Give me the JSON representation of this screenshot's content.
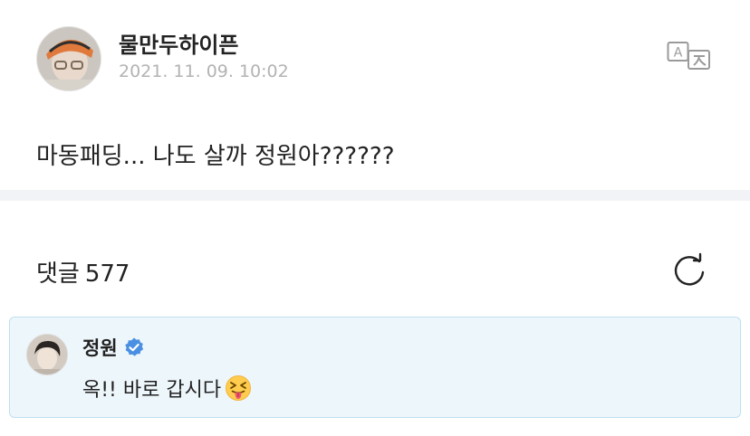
{
  "post": {
    "author": "물만두하이픈",
    "timestamp": "2021. 11. 09. 10:02",
    "body": "마동패딩... 나도 살까 정원아??????"
  },
  "comments": {
    "label": "댓글",
    "count": "577"
  },
  "comment": {
    "author": "정원",
    "text": "옥!! 바로 갑시다"
  },
  "icons": {
    "translate": "translate-icon",
    "refresh": "refresh-icon",
    "verified": "verified-badge-icon",
    "emoji": "squinting-tongue-emoji"
  },
  "colors": {
    "timestamp": "#b3b3b3",
    "comment_bg": "#edf6fb",
    "comment_border": "#bfe0ef",
    "verified": "#4a90e2",
    "divider": "#f1f3f6"
  }
}
